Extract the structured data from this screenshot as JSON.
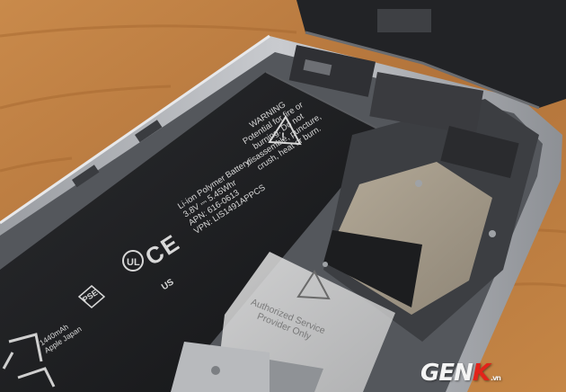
{
  "image": {
    "description_free": true
  },
  "battery": {
    "warning_lines": [
      "WARNING",
      "Potential for fire or",
      "burning. Do not",
      "disassemble, puncture,",
      "crush, heat or burn."
    ],
    "spec_lines": [
      "Li-ion Polymer Battery",
      "3.8V ⎓ 5.45Whr",
      "APN: 616-0613",
      "VPN: LIS1491APPCS"
    ],
    "ce_mark": "CE",
    "ul_mark": "US",
    "pse_mark": "PSE",
    "capacity_lines": [
      "1440mAh",
      "Apple Japan"
    ]
  },
  "sticker": {
    "lines": [
      "Authorized Service",
      "Provider Only"
    ]
  },
  "watermark": {
    "prefix": "GEN",
    "accent": "K",
    "suffix": ".vn",
    "accent_color": "#e2231a"
  }
}
